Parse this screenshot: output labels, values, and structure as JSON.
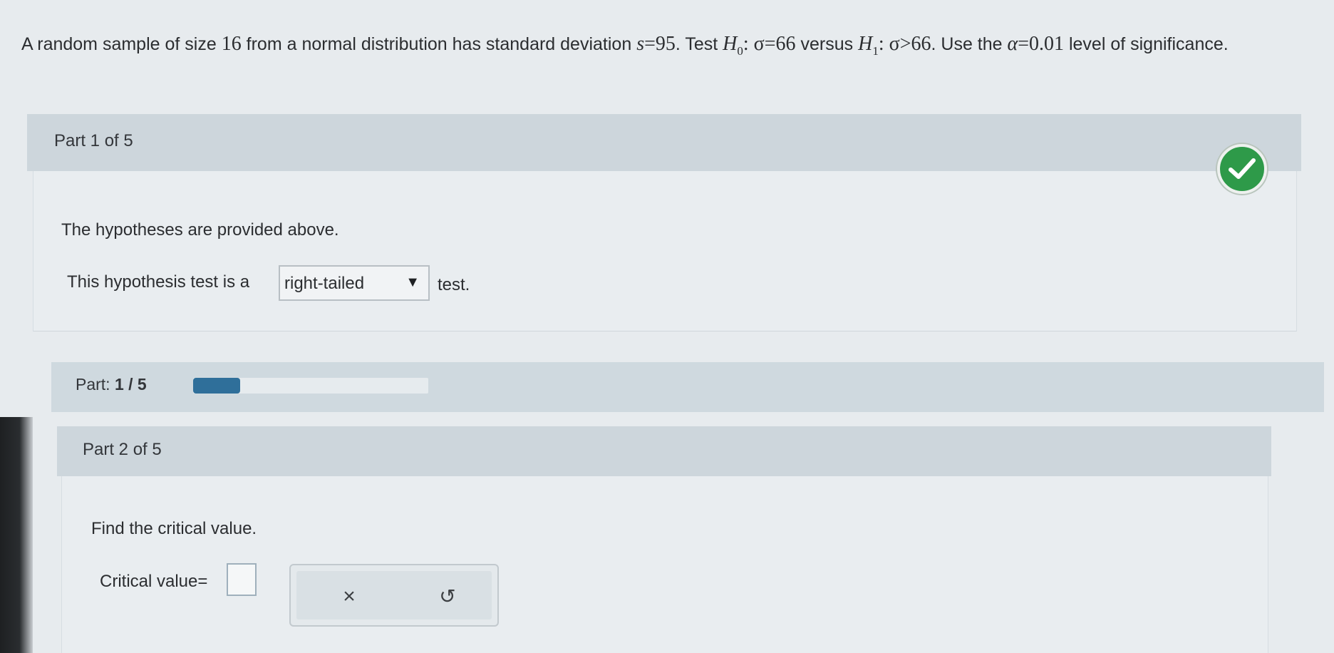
{
  "question": {
    "intro": "A random sample of size",
    "n": "16",
    "mid1": "from a normal distribution has standard deviation",
    "s_var": "s",
    "s_eq": "=95",
    "mid2": ". Test",
    "h0_var": "H",
    "h0_sub": "0",
    "h0_rel": ": σ=66",
    "mid3": "versus",
    "h1_var": "H",
    "h1_sub": "1",
    "h1_rel": ": σ>66",
    "mid4": ". Use the",
    "alpha_var": "α",
    "alpha_eq": "=0.01",
    "outro": "level of significance."
  },
  "part1": {
    "title": "Part 1 of 5",
    "status_icon": "checkmark-icon",
    "status_color": "#2e9a49",
    "hypotheses_text": "The hypotheses are provided above.",
    "test_prefix": "This hypothesis test is a",
    "test_suffix": "test.",
    "tail_select": {
      "selected": "right-tailed",
      "arrow": "▼"
    }
  },
  "progress": {
    "label": "Part:",
    "value_text": "1 / 5",
    "fraction": 0.2,
    "fill_color": "#2f6f9a"
  },
  "part2": {
    "title": "Part 2 of 5",
    "prompt": "Find the critical value.",
    "critical_label": "Critical value=",
    "critical_value": "",
    "clear_symbol": "×",
    "undo_symbol": "↺"
  }
}
